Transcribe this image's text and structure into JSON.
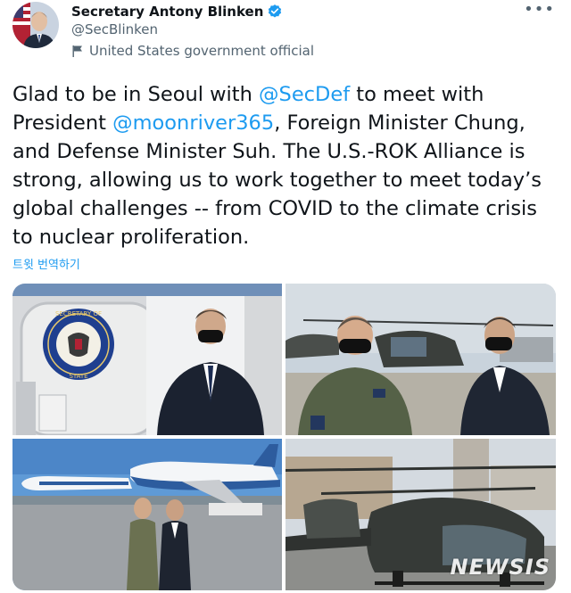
{
  "author": {
    "display_name": "Secretary Antony Blinken",
    "handle": "@SecBlinken",
    "label": "United States government official",
    "verified_color": "#1d9bf0"
  },
  "menu": {
    "more_glyph": "•••"
  },
  "tweet": {
    "seg1": "Glad to be in Seoul with ",
    "mention1": "@SecDef",
    "seg2": " to meet with President ",
    "mention2": "@moonriver365",
    "seg3": ", Foreign Minister Chung, and Defense Minister Suh. The U.S.-ROK Alliance is strong, allowing us to work together to meet today’s global challenges -- from COVID to the climate crisis to nuclear proliferation."
  },
  "translate_label": "트윗 번역하기",
  "photos": {
    "seal_top": "SECRETARY OF",
    "seal_bottom": "STATE",
    "watermark": "NEWSIS"
  },
  "colors": {
    "link": "#1d9bf0",
    "secondary": "#536471"
  }
}
